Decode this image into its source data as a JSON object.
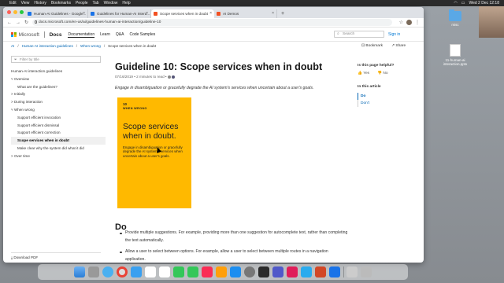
{
  "menubar": {
    "apple": "",
    "items": [
      "Edit",
      "View",
      "History",
      "Bookmarks",
      "People",
      "Tab",
      "Window",
      "Help"
    ],
    "clock": "Wed 2 Dec 12:18"
  },
  "desktop": {
    "icons": [
      {
        "label": "misc",
        "icon": "folder-icon"
      },
      {
        "label": "11-human-ai interaction.pptx",
        "icon": "file-icon"
      }
    ]
  },
  "browser": {
    "tabs": [
      {
        "label": "Human-AI Guidelines - Google...",
        "favicon_color": "#1a73e8",
        "active": false
      },
      {
        "label": "Guidelines for Human-AI Intera...",
        "favicon_color": "#1a73e8",
        "active": false
      },
      {
        "label": "Scope services when in doubt",
        "favicon_color": "#f25022",
        "active": true
      },
      {
        "label": "AI Demos",
        "favicon_color": "#f25022",
        "active": false
      }
    ],
    "new_tab": "+",
    "url": "docs.microsoft.com/en-us/ai/guidelines-human-ai-interaction/guideline-10"
  },
  "site": {
    "brand": "Microsoft",
    "product": "Docs",
    "nav": [
      "Documentation",
      "Learn",
      "Q&A",
      "Code Samples"
    ],
    "search_placeholder": "Search",
    "signin": "Sign in",
    "bookmark": "Bookmark",
    "share": "Share"
  },
  "breadcrumb": [
    "AI",
    "Human-AI interaction guidelines",
    "When wrong",
    "Scope services when in doubt"
  ],
  "leftnav": {
    "filter_placeholder": "Filter by title",
    "items": [
      {
        "label": "Human-AI interaction guidelines",
        "indent": 0,
        "selected": false
      },
      {
        "label": "˅ Overview",
        "indent": 0,
        "selected": false
      },
      {
        "label": "What are the guidelines?",
        "indent": 1,
        "selected": false
      },
      {
        "label": "> Initially",
        "indent": 0,
        "selected": false
      },
      {
        "label": "> During interaction",
        "indent": 0,
        "selected": false
      },
      {
        "label": "˅ When wrong",
        "indent": 0,
        "selected": false
      },
      {
        "label": "Support efficient invocation",
        "indent": 1,
        "selected": false
      },
      {
        "label": "Support efficient dismissal",
        "indent": 1,
        "selected": false
      },
      {
        "label": "Support efficient correction",
        "indent": 1,
        "selected": false
      },
      {
        "label": "Scope services when in doubt",
        "indent": 1,
        "selected": true
      },
      {
        "label": "Make clear why the system did what it did",
        "indent": 1,
        "selected": false
      },
      {
        "label": "> Over time",
        "indent": 0,
        "selected": false
      }
    ],
    "download": "Download PDF"
  },
  "article": {
    "title": "Guideline 10: Scope services when in doubt",
    "meta": "07/16/2019 • 2 minutes to read •",
    "intro": "Engage in disambiguation or gracefully degrade the AI system's services when uncertain about a user's goals.",
    "card": {
      "number": "10",
      "kind": "WHEN WRONG",
      "title": "Scope services when in doubt.",
      "text": "Engage in disambiguation or gracefully degrade the AI system's services when uncertain about a user's goals.",
      "color": "#ffb900"
    },
    "section": "Do",
    "bullets": [
      "Provide multiple suggestions. For example, providing more than one suggestion for autocomplete text, rather than completing the text automatically.",
      "Allow a user to select between options. For example, allow a user to select between multiple routes in a navigation application."
    ]
  },
  "rail": {
    "helpful_q": "Is this page helpful?",
    "yes": "Yes",
    "no": "No",
    "in_article": "In this article",
    "toc": [
      "Do",
      "Don't"
    ]
  }
}
